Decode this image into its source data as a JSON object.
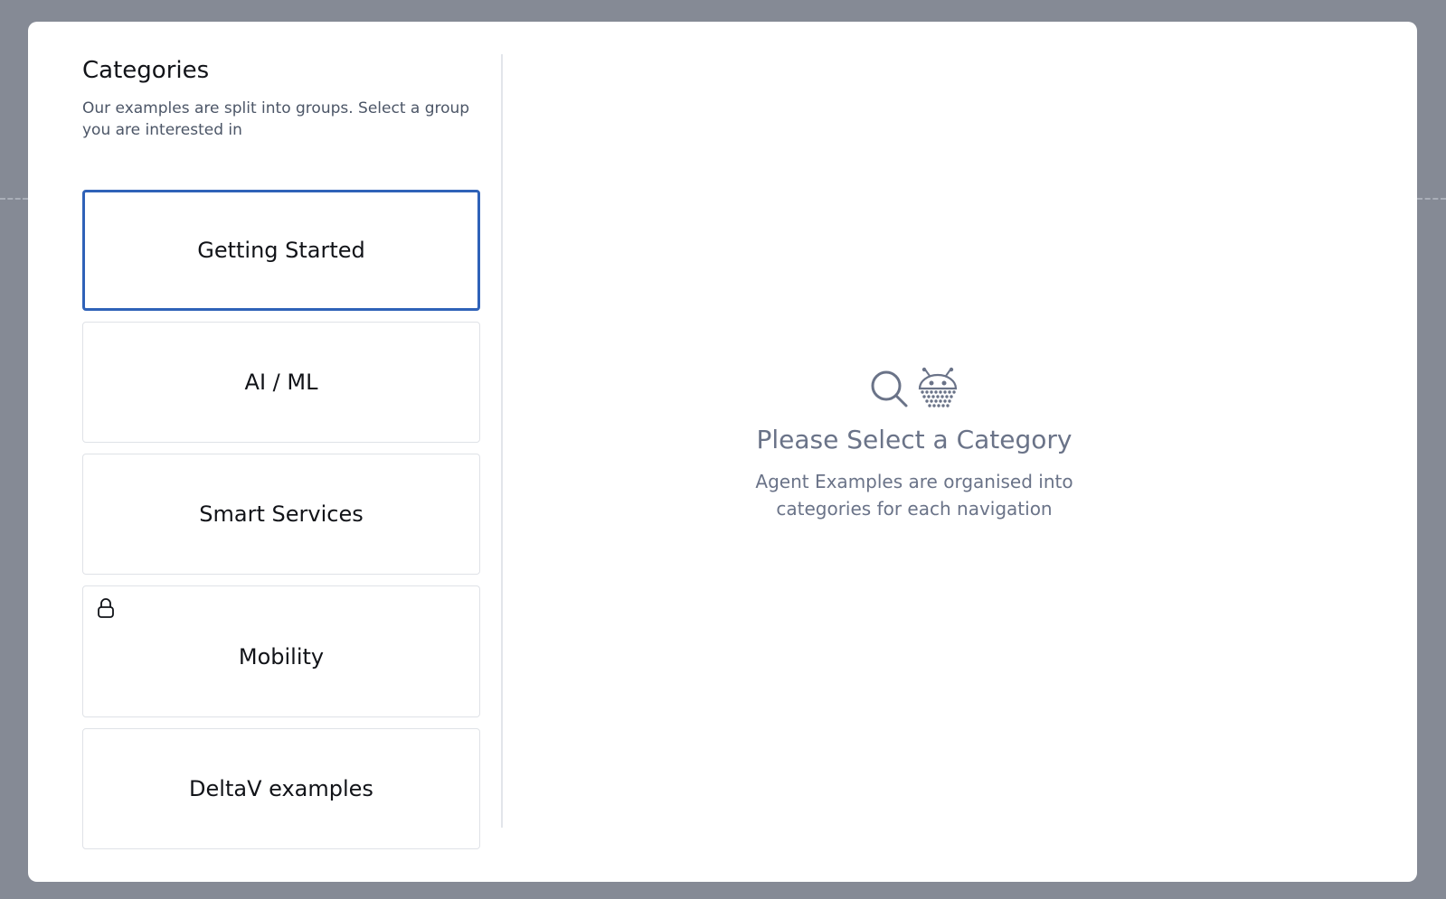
{
  "modal": {
    "title": "Categories",
    "subtitle": "Our examples are split into groups. Select a group you are interested in"
  },
  "categories": [
    {
      "label": "Getting Started",
      "selected": true,
      "locked": false
    },
    {
      "label": "AI / ML",
      "selected": false,
      "locked": false
    },
    {
      "label": "Smart Services",
      "selected": false,
      "locked": false
    },
    {
      "label": "Mobility",
      "selected": false,
      "locked": true
    },
    {
      "label": "DeltaV examples",
      "selected": false,
      "locked": false
    }
  ],
  "empty_state": {
    "icons": [
      "search-icon",
      "agent-robot-icon"
    ],
    "title": "Please Select a Category",
    "description": "Agent Examples are organised into categories for each navigation"
  },
  "colors": {
    "selected_border": "#2f62b8",
    "overlay": "#858a95",
    "muted_text": "#6a7388"
  }
}
